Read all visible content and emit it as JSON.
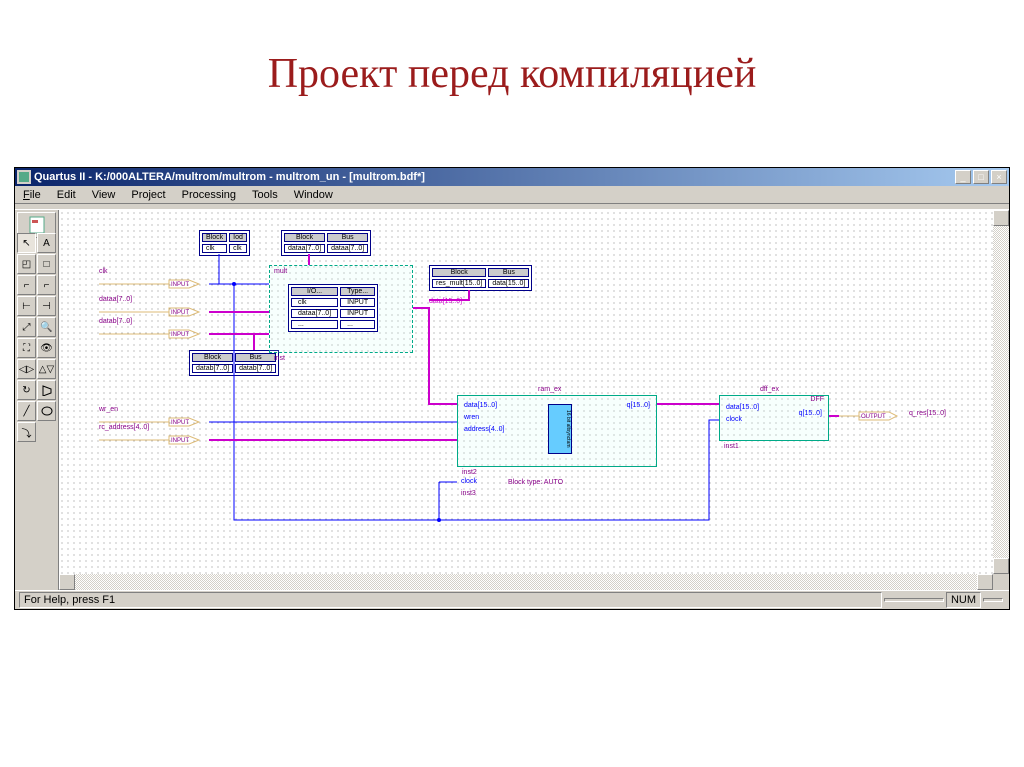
{
  "slide": {
    "title": "Проект перед компиляцией"
  },
  "window": {
    "title": "Quartus II - K:/000ALTERA/multrom/multrom - multrom_un - [multrom.bdf*]",
    "minimize": "_",
    "maximize": "□",
    "close": "×"
  },
  "menu": {
    "file": "File",
    "edit": "Edit",
    "view": "View",
    "project": "Project",
    "processing": "Processing",
    "tools": "Tools",
    "window": "Window"
  },
  "tools": {
    "arrow": "↖",
    "text": "A",
    "symbol": "◰",
    "block": "□",
    "ortho": "⌐",
    "diag": "⌐",
    "conduit": "⊢",
    "partial": "⊣",
    "zoomfit": "⤢",
    "zoom": "🔍",
    "fs": "⛶",
    "find": "👁",
    "fliph": "◁▷",
    "flipv": "△▽",
    "rotate": "↻",
    "line": "╱",
    "arc": "⤵"
  },
  "status": {
    "help": "For Help, press F1",
    "num": "NUM"
  },
  "schematic": {
    "inputs": {
      "clk": "clk",
      "dataa": "dataa[7..0]",
      "datab": "datab[7..0]",
      "wr_en": "wr_en",
      "rc_address": "rc_address[4..0]",
      "input_label": "INPUT",
      "output_label": "OUTPUT"
    },
    "conduit1": {
      "h_block": "Block",
      "h_node": "Iod",
      "block": "clk",
      "node": "clk"
    },
    "conduit2": {
      "h_block": "Block",
      "h_bus": "Bus",
      "block": "dataa[7..0]",
      "bus": "dataa[7..0]"
    },
    "conduit3": {
      "h_block": "Block",
      "h_bus": "Bus",
      "block": "datab[7..0]",
      "bus": "datab[7..0]"
    },
    "conduit4": {
      "h_block": "Block",
      "h_bus": "Bus",
      "block": "res_mult[15..0]",
      "bus": "data[15..0]"
    },
    "mult_block": {
      "name": "mult",
      "h_io": "I/O...",
      "h_type": "Type...",
      "r1_io": "clk",
      "r1_type": "INPUT",
      "r2_io": "dataa[7..0]",
      "r2_type": "INPUT",
      "r3_io": "...",
      "r3_type": "...",
      "inst": "inst"
    },
    "ram_block": {
      "name": "ram_ex",
      "data": "data[15..0]",
      "wren": "wren",
      "address": "address[4..0]",
      "clock": "clock",
      "q": "q[15..0]",
      "core": "16 bit\naltsynctam",
      "blocktype": "Block type: AUTO",
      "inst": "inst2",
      "inst_clock": "inst3"
    },
    "dff_block": {
      "name": "dff_ex",
      "type": "DFF",
      "data": "data[15..0]",
      "clock": "clock",
      "q": "q[15..0]",
      "inst": "inst1"
    },
    "output": {
      "name": "q_res[15..0]"
    },
    "wire_label1": "data[15..0]"
  }
}
